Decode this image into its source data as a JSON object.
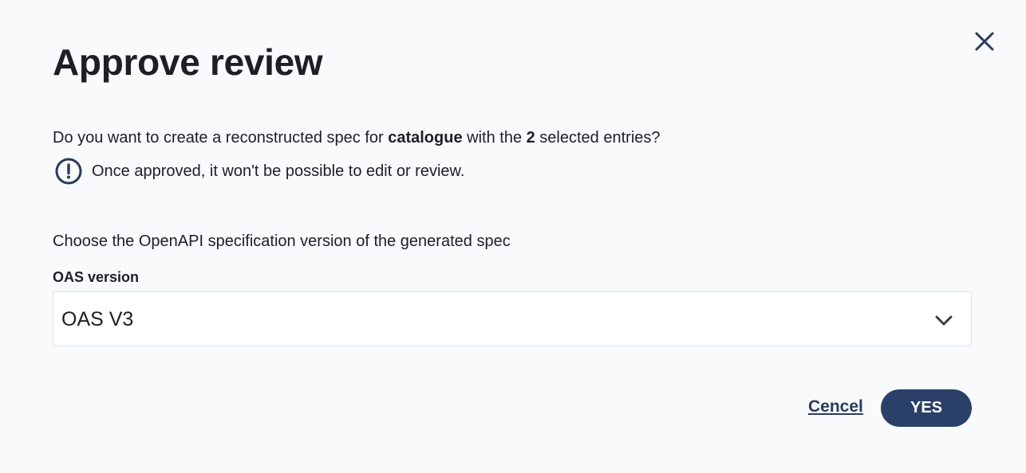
{
  "dialog": {
    "title": "Approve review",
    "question": {
      "prefix": "Do you want to create a reconstructed spec for ",
      "api_name": "catalogue",
      "middle": " with the ",
      "count": "2",
      "suffix": " selected entries?"
    },
    "warning": {
      "icon": "exclamation-circle-icon",
      "text": "Once approved, it won't be possible to edit or review."
    },
    "choose_text": "Choose the OpenAPI specification version of the generated spec",
    "oas_field": {
      "label": "OAS version",
      "selected_value": "OAS V3"
    },
    "actions": {
      "cancel_label": "Cencel",
      "confirm_label": "YES"
    },
    "close_icon": "close-icon"
  },
  "colors": {
    "background": "#f8fafc",
    "primary": "#2b4068",
    "text": "#1c1f24",
    "link": "#2b3a5c",
    "icon": "#2b3a5c"
  }
}
